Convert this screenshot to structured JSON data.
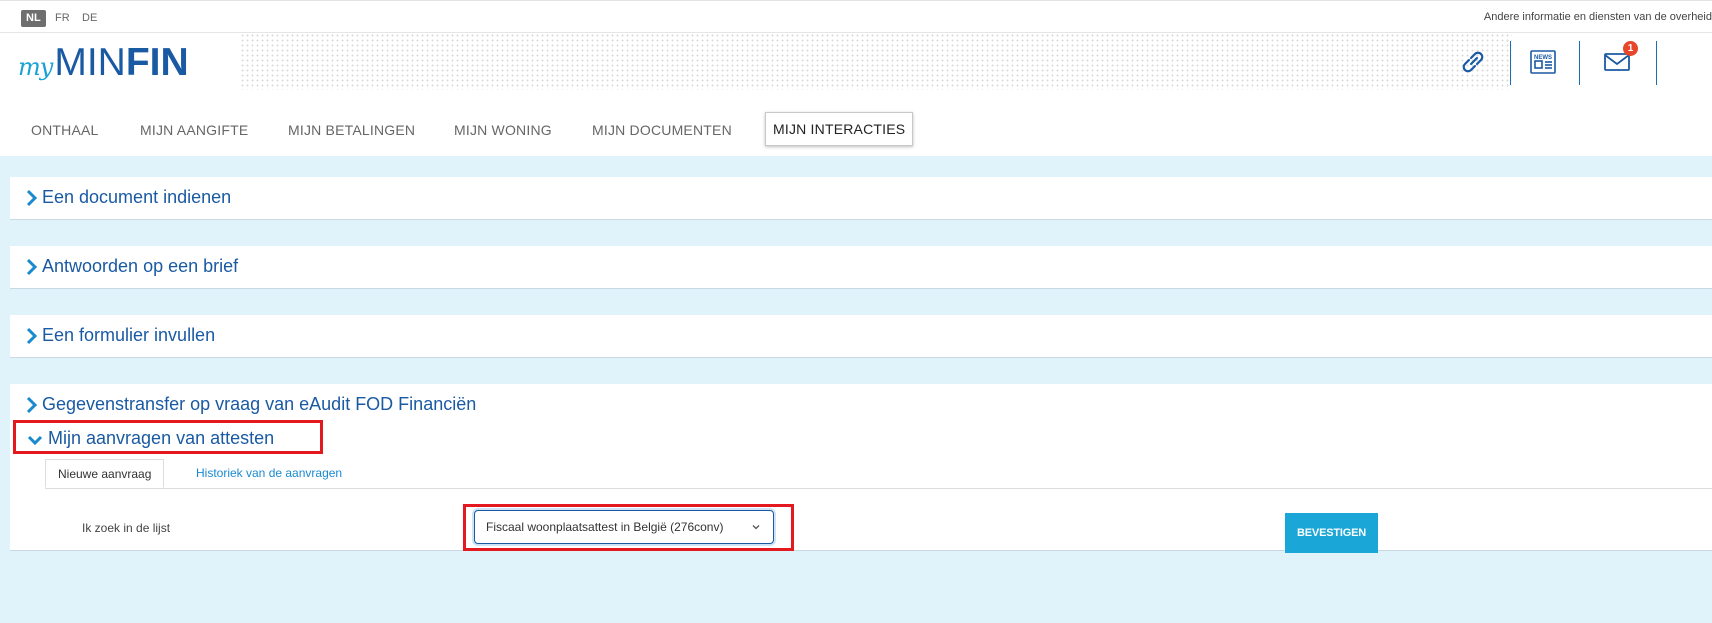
{
  "languages": {
    "nl": "NL",
    "fr": "FR",
    "de": "DE"
  },
  "topbar": {
    "right_text": "Andere informatie en diensten van de overheid"
  },
  "logo": {
    "my": "my",
    "min": "MIN",
    "fin": "FIN"
  },
  "header": {
    "notification_count": "1"
  },
  "nav": {
    "items": [
      "ONTHAAL",
      "MIJN AANGIFTE",
      "MIJN BETALINGEN",
      "MIJN WONING",
      "MIJN DOCUMENTEN",
      "MIJN INTERACTIES"
    ],
    "active": "MIJN INTERACTIES"
  },
  "panels": [
    "Een document indienen",
    "Antwoorden op een brief",
    "Een formulier invullen",
    "Gegevenstransfer op vraag van eAudit FOD Financiën"
  ],
  "open_panel": {
    "title": "Mijn aanvragen van attesten",
    "tabs": [
      "Nieuwe aanvraag",
      "Historiek van de aanvragen"
    ],
    "search_label": "Ik zoek in de lijst",
    "selected_option": "Fiscaal woonplaatsattest in België (276conv)",
    "confirm_button": "BEVESTIGEN"
  },
  "colors": {
    "brand_dark": "#1a5aa3",
    "brand_light": "#1aa6d6",
    "background": "#e0f3fa",
    "highlight": "#e3191f",
    "badge": "#e8462a"
  }
}
